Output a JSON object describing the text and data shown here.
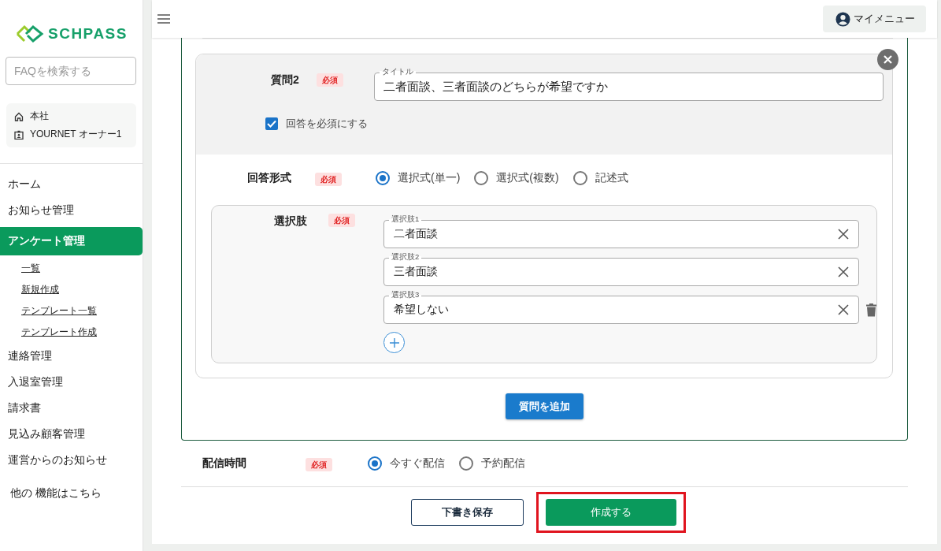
{
  "logo": {
    "text": "SCHPASS"
  },
  "sidebar": {
    "search": {
      "placeholder": "FAQを検索する"
    },
    "org": {
      "office": "本社",
      "user": "YOURNET オーナー1"
    },
    "items": [
      {
        "label": "ホーム",
        "selected": false
      },
      {
        "label": "お知らせ管理",
        "selected": false
      },
      {
        "label": "アンケート管理",
        "selected": true,
        "children": [
          {
            "label": "一覧"
          },
          {
            "label": "新規作成"
          },
          {
            "label": "テンプレート一覧"
          },
          {
            "label": "テンプレート作成"
          }
        ]
      },
      {
        "label": "連絡管理",
        "selected": false
      },
      {
        "label": "入退室管理",
        "selected": false
      },
      {
        "label": "請求書",
        "selected": false
      },
      {
        "label": "見込み顧客管理",
        "selected": false
      },
      {
        "label": "運営からのお知らせ",
        "selected": false
      }
    ],
    "more_link": "他の 機能はこちら"
  },
  "header": {
    "my_menu": "マイメニュー"
  },
  "question": {
    "label": "質問2",
    "badge": "必須",
    "title_field": {
      "label": "タイトル",
      "value": "二者面談、三者面談のどちらが希望ですか"
    },
    "required_checkbox": {
      "label": "回答を必須にする",
      "checked": true
    },
    "answer_type": {
      "label": "回答形式",
      "badge": "必須",
      "options": [
        {
          "label": "選択式(単一)",
          "selected": true
        },
        {
          "label": "選択式(複数)",
          "selected": false
        },
        {
          "label": "記述式",
          "selected": false
        }
      ]
    },
    "choices": {
      "label": "選択肢",
      "badge": "必須",
      "items": [
        {
          "label": "選択肢1",
          "value": "二者面談",
          "deletable": false
        },
        {
          "label": "選択肢2",
          "value": "三者面談",
          "deletable": false
        },
        {
          "label": "選択肢3",
          "value": "希望しない",
          "deletable": true
        }
      ]
    }
  },
  "add_question_button": "質問を追加",
  "delivery": {
    "label": "配信時間",
    "badge": "必須",
    "options": [
      {
        "label": "今すぐ配信",
        "selected": true
      },
      {
        "label": "予約配信",
        "selected": false
      }
    ]
  },
  "buttons": {
    "draft": "下書き保存",
    "create": "作成する",
    "create_highlighted": true
  }
}
